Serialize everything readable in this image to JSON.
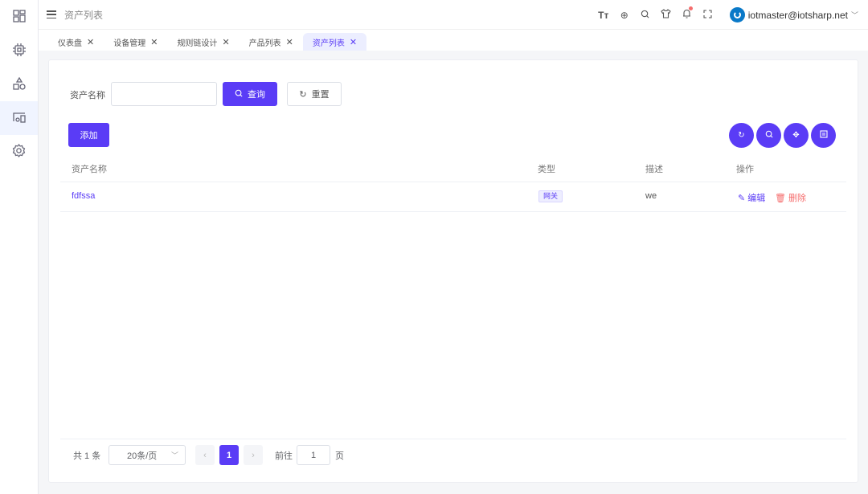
{
  "header": {
    "breadcrumb": "资产列表",
    "user": "iotmaster@iotsharp.net"
  },
  "tabs": [
    {
      "label": "仪表盘"
    },
    {
      "label": "设备管理"
    },
    {
      "label": "规则链设计"
    },
    {
      "label": "产品列表"
    },
    {
      "label": "资产列表",
      "active": true
    }
  ],
  "search": {
    "label": "资产名称",
    "value": "",
    "query_label": "查询",
    "reset_label": "重置"
  },
  "toolbar": {
    "add_label": "添加"
  },
  "table": {
    "columns": [
      "资产名称",
      "类型",
      "描述",
      "操作"
    ],
    "rows": [
      {
        "name": "fdfssa",
        "type": "网关",
        "desc": "we",
        "edit": "编辑",
        "delete": "删除"
      }
    ]
  },
  "pagination": {
    "total": "共 1 条",
    "page_size": "20条/页",
    "current": "1",
    "goto_label": "前往",
    "goto_value": "1",
    "page_suffix": "页"
  },
  "colors": {
    "accent": "#5a3cf6",
    "danger": "#f56c6c"
  }
}
